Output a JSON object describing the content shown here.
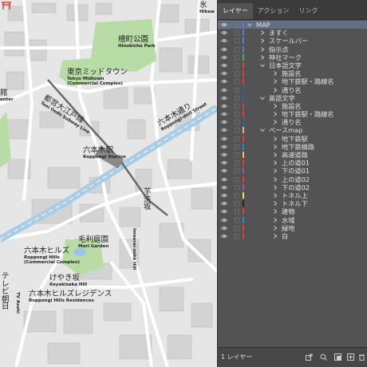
{
  "map": {
    "labels": {
      "hinokicho_ja": "檜町公園",
      "hinokicho_en": "Hinokicho Park",
      "midtown_ja": "東京ミッドタウン",
      "midtown_en1": "Tokyo Midtown",
      "midtown_en2": "(Commercial Complex)",
      "oedo_ja": "都営大江戸線",
      "oedo_en": "Toei Oedo Subway Line",
      "roppongi_dori_ja": "六本木通り",
      "roppongi_dori_en": "Roppongi-dori Street",
      "station_ja": "六本木駅",
      "station_en": "Roppongi Station",
      "imoarai_ja": "芋洗坂",
      "imoarai_en": "Imoarai-zaka Hill",
      "mori_garden_ja": "毛利庭園",
      "mori_garden_en": "Mori Garden",
      "hills_ja": "六本木ヒルズ",
      "hills_en1": "Roppongi Hills",
      "hills_en2": "(Commercial Complex)",
      "keyakizaka_ja": "けやき坂",
      "keyakizaka_en": "Keyakizaka Hill",
      "residences_ja": "六本木ヒルズレジデンス",
      "residences_en": "Roppongi Hills Residences",
      "tvasahi_ja": "テレビ朝日",
      "tvasahi_en": "TV Asahi",
      "top_right_ja": "氷",
      "top_right_en": "Hikaw",
      "left_edge_1": "館",
      "left_edge_2": "enter"
    }
  },
  "panel": {
    "tabs": [
      "レイヤー",
      "アクション",
      "リンク"
    ],
    "rows": [
      {
        "label": "MAP",
        "level": 0,
        "color": "#5b7bd5",
        "expanded": true,
        "selected": true
      },
      {
        "label": "ますく",
        "level": 1,
        "color": "#5b7bd5",
        "expanded": false
      },
      {
        "label": "スケールバー",
        "level": 1,
        "color": "#5b7bd5",
        "expanded": false
      },
      {
        "label": "指示点",
        "level": 1,
        "color": "#5b7bd5",
        "expanded": false
      },
      {
        "label": "神社マーク",
        "level": 1,
        "color": "#4caf50",
        "expanded": false
      },
      {
        "label": "日本語文字",
        "level": 1,
        "color": "#e53935",
        "expanded": true
      },
      {
        "label": "施設名",
        "level": 2,
        "color": "#e53935",
        "expanded": false
      },
      {
        "label": "地下鉄駅・路線名",
        "level": 2,
        "color": "#e53935",
        "expanded": false
      },
      {
        "label": "通り名",
        "level": 2,
        "color": "#3f51b5",
        "expanded": false
      },
      {
        "label": "英語文字",
        "level": 1,
        "color": "#3f51b5",
        "expanded": true
      },
      {
        "label": "施設名",
        "level": 2,
        "color": "#e53935",
        "expanded": false
      },
      {
        "label": "地下鉄駅・路線名",
        "level": 2,
        "color": "#e53935",
        "expanded": false
      },
      {
        "label": "通り名",
        "level": 2,
        "color": "#3f51b5",
        "expanded": false
      },
      {
        "label": "ベースmap",
        "level": 1,
        "color": "#f4a3a3",
        "expanded": true
      },
      {
        "label": "地下鉄駅",
        "level": 2,
        "color": "#e53935",
        "expanded": false
      },
      {
        "label": "地下鉄線路",
        "level": 2,
        "color": "#1e88e5",
        "expanded": false
      },
      {
        "label": "高速道路",
        "level": 2,
        "color": "#ffb74d",
        "expanded": false
      },
      {
        "label": "上の道01",
        "level": 2,
        "color": "#e53935",
        "expanded": false
      },
      {
        "label": "下の道01",
        "level": 2,
        "color": "#ab47bc",
        "expanded": false
      },
      {
        "label": "上の道02",
        "level": 2,
        "color": "#e53935",
        "expanded": false
      },
      {
        "label": "下の道02",
        "level": 2,
        "color": "#ab47bc",
        "expanded": false
      },
      {
        "label": "トネル上",
        "level": 2,
        "color": "#f4e04d",
        "expanded": false
      },
      {
        "label": "トネル下",
        "level": 2,
        "color": "#222222",
        "expanded": false
      },
      {
        "label": "建物",
        "level": 2,
        "color": "#e53935",
        "expanded": false
      },
      {
        "label": "水域",
        "level": 2,
        "color": "#1e88e5",
        "expanded": false
      },
      {
        "label": "緑地",
        "level": 2,
        "color": "#e53935",
        "expanded": false
      },
      {
        "label": "白",
        "level": 2,
        "color": "#e53935",
        "expanded": false
      }
    ],
    "footer": {
      "layer_count": "1 レイヤー"
    }
  }
}
